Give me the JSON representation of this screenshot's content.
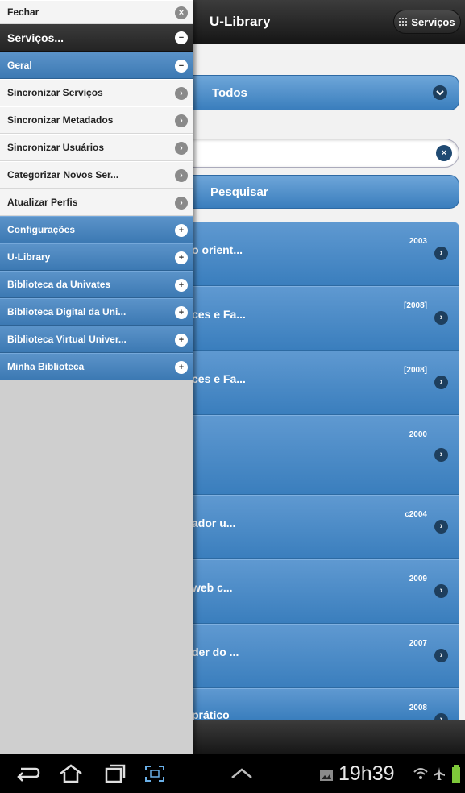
{
  "app": {
    "title": "U-Library",
    "services_button": "Serviços",
    "filter_select": "Todos",
    "search_button": "Pesquisar"
  },
  "results": [
    {
      "title": "o orient...",
      "year": "2003"
    },
    {
      "title": "ces e Fa...",
      "year": "[2008]"
    },
    {
      "title": "ces e Fa...",
      "year": "[2008]"
    },
    {
      "title": "",
      "year": "2000"
    },
    {
      "title": "ador u...",
      "year": "c2004"
    },
    {
      "title": "web c...",
      "year": "2009"
    },
    {
      "title": "der do ...",
      "year": "2007"
    },
    {
      "title": "prático",
      "year": "2008"
    }
  ],
  "panel": {
    "close_label": "Fechar",
    "header_label": "Serviços...",
    "items": [
      {
        "label": "Geral",
        "style": "blue",
        "icon": "minus-icon"
      },
      {
        "label": "Sincronizar Serviços",
        "style": "light",
        "icon": "arrow-right-icon"
      },
      {
        "label": "Sincronizar Metadados",
        "style": "light",
        "icon": "arrow-right-icon"
      },
      {
        "label": "Sincronizar Usuários",
        "style": "light",
        "icon": "arrow-right-icon"
      },
      {
        "label": "Categorizar Novos Ser...",
        "style": "light",
        "icon": "arrow-right-icon"
      },
      {
        "label": "Atualizar Perfis",
        "style": "light",
        "icon": "arrow-right-icon"
      },
      {
        "label": "Configurações",
        "style": "blue",
        "icon": "plus-icon"
      },
      {
        "label": "U-Library",
        "style": "blue",
        "icon": "plus-icon"
      },
      {
        "label": "Biblioteca da Univates",
        "style": "blue",
        "icon": "plus-icon"
      },
      {
        "label": "Biblioteca Digital da Uni...",
        "style": "blue",
        "icon": "plus-icon"
      },
      {
        "label": "Biblioteca Virtual Univer...",
        "style": "blue",
        "icon": "plus-icon"
      },
      {
        "label": "Minha Biblioteca",
        "style": "blue",
        "icon": "plus-icon"
      }
    ]
  },
  "system_bar": {
    "clock": "19h39"
  },
  "colors": {
    "accent_blue": "#3a7ebd",
    "header_dark": "#242424",
    "panel_bg": "#cfcfcf"
  }
}
